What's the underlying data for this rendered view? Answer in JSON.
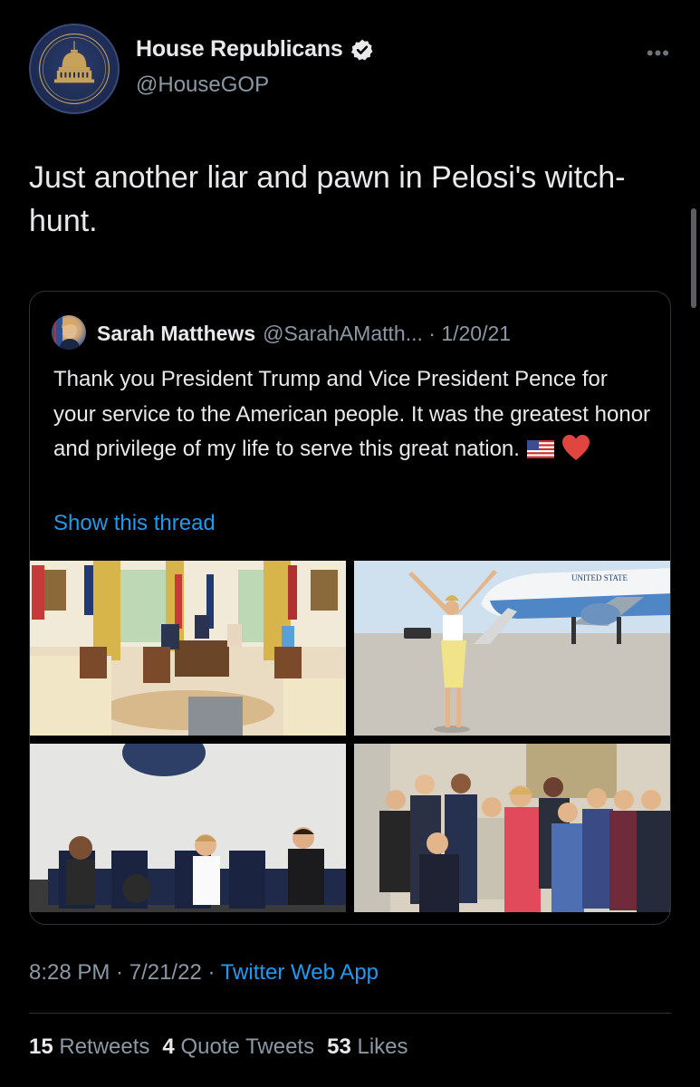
{
  "author": {
    "display_name": "House Republicans",
    "handle": "@HouseGOP",
    "verified": true,
    "avatar_icon": "capitol-dome-seal"
  },
  "tweet": {
    "text": "Just another liar and pawn in Pelosi's witch-hunt.",
    "more_icon": "ellipsis-icon"
  },
  "quote": {
    "name": "Sarah Matthews",
    "handle": "@SarahAMatth...",
    "separator": " · ",
    "date": "1/20/21",
    "text": "Thank you President Trump and Vice President Pence for your service to the American people. It was the greatest honor and privilege of my life to serve this great nation.",
    "emojis": [
      "us-flag-icon",
      "red-heart-icon"
    ],
    "show_thread": "Show this thread",
    "photos": [
      "oval-office",
      "air-force-one",
      "waiting-room",
      "group-photo"
    ],
    "plane_text": "UNITED STATE"
  },
  "meta": {
    "time": "8:28 PM",
    "sep1": " · ",
    "date": "7/21/22",
    "sep2": " · ",
    "source": "Twitter Web App"
  },
  "stats": {
    "retweets_count": "15",
    "retweets_label": " Retweets",
    "quotes_count": "4",
    "quotes_label": " Quote Tweets",
    "likes_count": "53",
    "likes_label": " Likes"
  },
  "colors": {
    "background": "#000000",
    "text": "#e7e9ea",
    "secondary": "#8b98a5",
    "link": "#1d9bf0",
    "border": "#2f3336"
  }
}
